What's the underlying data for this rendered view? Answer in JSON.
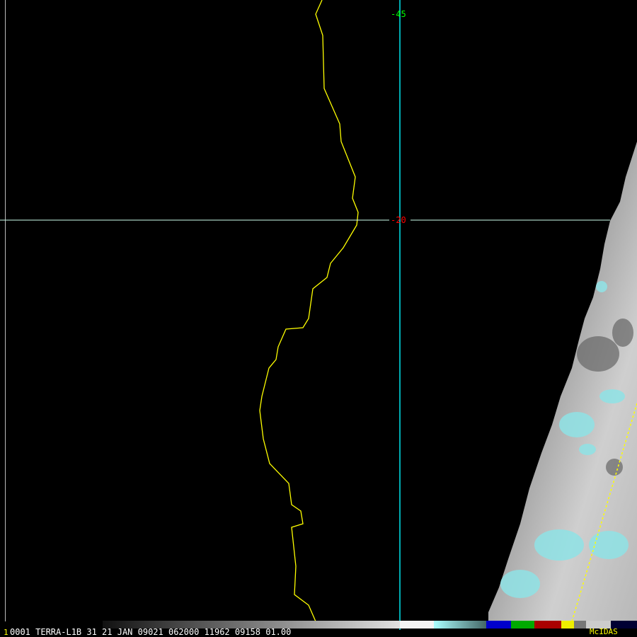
{
  "image": {
    "frame_number": "1",
    "info_line": "0001 TERRA-L1B 31 21 JAN 09021 062000 11962 09158 01.00",
    "brand": "McIDAS",
    "grid_labels": [
      {
        "text": "-45",
        "color": "#00ff00"
      },
      {
        "text": "-20",
        "color": "#ff0000"
      }
    ],
    "colors": {
      "grid_line": "#00e5ee",
      "coastline": "#ffff00",
      "background": "#000000"
    }
  }
}
